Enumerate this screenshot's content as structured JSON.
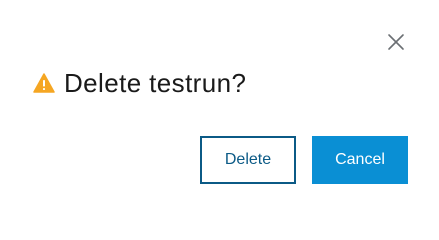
{
  "dialog": {
    "title": "Delete testrun?",
    "icon": "warning-icon",
    "close_icon": "close-icon",
    "buttons": {
      "delete_label": "Delete",
      "cancel_label": "Cancel"
    }
  },
  "colors": {
    "warning": "#f5a623",
    "delete_border": "#0b5a86",
    "cancel_bg": "#0a8fd4",
    "close_icon": "#6b6f73"
  }
}
